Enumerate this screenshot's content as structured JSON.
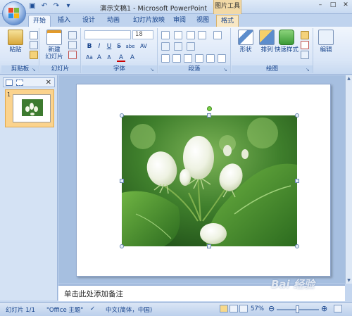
{
  "window": {
    "title": "演示文稿1 - Microsoft PowerPoint",
    "context_header": "图片工具"
  },
  "tabs": [
    {
      "label": "开始",
      "active": true
    },
    {
      "label": "插入"
    },
    {
      "label": "设计"
    },
    {
      "label": "动画"
    },
    {
      "label": "幻灯片放映"
    },
    {
      "label": "审阅"
    },
    {
      "label": "视图"
    },
    {
      "label": "格式",
      "context": true
    }
  ],
  "ribbon": {
    "clipboard": {
      "paste": "粘贴",
      "label": "剪贴板"
    },
    "slides": {
      "new_slide_l1": "新建",
      "new_slide_l2": "幻灯片",
      "label": "幻灯片"
    },
    "font": {
      "size": "18",
      "label": "字体",
      "bold": "B",
      "italic": "I",
      "underline": "U",
      "strike": "S",
      "shadow": "abe",
      "spacing": "AV",
      "grow": "A",
      "shrink": "A",
      "case": "Aa",
      "color": "A",
      "clear": "A"
    },
    "paragraph": {
      "label": "段落"
    },
    "drawing": {
      "shape": "形状",
      "arrange": "排列",
      "quick_style": "快速样式",
      "label": "绘图"
    },
    "editing": {
      "label": "编辑"
    }
  },
  "left_panel": {
    "slide_number": "1"
  },
  "notes": {
    "placeholder": "单击此处添加备注"
  },
  "status": {
    "slide": "幻灯片 1/1",
    "theme": "\"Office 主题\"",
    "language": "中文(简体，中国)",
    "zoom": "57%",
    "zoom_minus": "⊖",
    "zoom_plus": "⊕"
  },
  "watermark": "Bai 经验",
  "colors": {
    "ribbon_text": "#15428b",
    "context_tab": "#f8e7c3",
    "selected_thumb": "#fbd38d"
  }
}
